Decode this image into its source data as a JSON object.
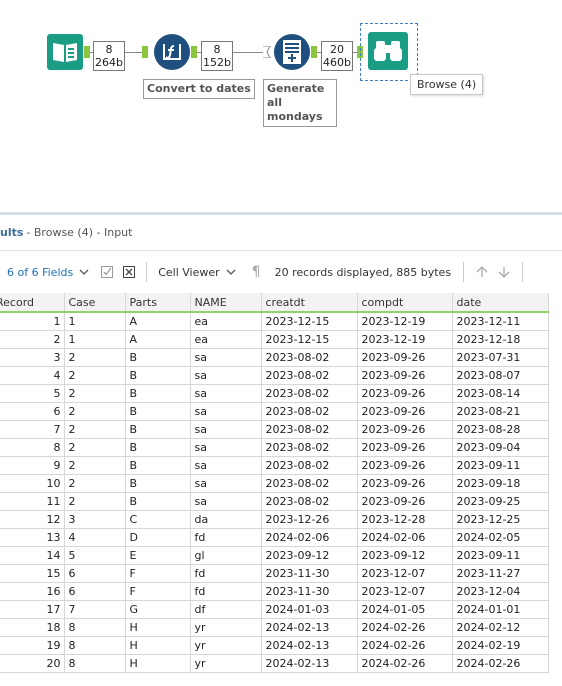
{
  "workflow": {
    "connections": [
      {
        "records": "8",
        "size": "264b"
      },
      {
        "records": "8",
        "size": "152b"
      },
      {
        "records": "20",
        "size": "460b"
      }
    ],
    "tools": {
      "formula_label": "Convert to dates",
      "generate_label": "Generate all mondays"
    },
    "tooltip": "Browse (4)"
  },
  "results": {
    "title": "ults",
    "subtitle": "- Browse (4) - Input"
  },
  "toolbar": {
    "fields_label": "6 of 6 Fields",
    "cell_viewer_label": "Cell Viewer",
    "records_info": "20 records displayed, 885 bytes"
  },
  "colors": {
    "accent": "#1f6fb5",
    "tool_teal": "#1a9c85",
    "tool_navy": "#1f4f7f",
    "anchor_green": "#8cc63f",
    "header_green_line": "#8fd26a"
  },
  "table": {
    "columns": [
      "Record",
      "Case",
      "Parts",
      "NAME",
      "creatdt",
      "compdt",
      "date"
    ],
    "rows": [
      [
        "1",
        "1",
        "A",
        "ea",
        "2023-12-15",
        "2023-12-19",
        "2023-12-11"
      ],
      [
        "2",
        "1",
        "A",
        "ea",
        "2023-12-15",
        "2023-12-19",
        "2023-12-18"
      ],
      [
        "3",
        "2",
        "B",
        "sa",
        "2023-08-02",
        "2023-09-26",
        "2023-07-31"
      ],
      [
        "4",
        "2",
        "B",
        "sa",
        "2023-08-02",
        "2023-09-26",
        "2023-08-07"
      ],
      [
        "5",
        "2",
        "B",
        "sa",
        "2023-08-02",
        "2023-09-26",
        "2023-08-14"
      ],
      [
        "6",
        "2",
        "B",
        "sa",
        "2023-08-02",
        "2023-09-26",
        "2023-08-21"
      ],
      [
        "7",
        "2",
        "B",
        "sa",
        "2023-08-02",
        "2023-09-26",
        "2023-08-28"
      ],
      [
        "8",
        "2",
        "B",
        "sa",
        "2023-08-02",
        "2023-09-26",
        "2023-09-04"
      ],
      [
        "9",
        "2",
        "B",
        "sa",
        "2023-08-02",
        "2023-09-26",
        "2023-09-11"
      ],
      [
        "10",
        "2",
        "B",
        "sa",
        "2023-08-02",
        "2023-09-26",
        "2023-09-18"
      ],
      [
        "11",
        "2",
        "B",
        "sa",
        "2023-08-02",
        "2023-09-26",
        "2023-09-25"
      ],
      [
        "12",
        "3",
        "C",
        "da",
        "2023-12-26",
        "2023-12-28",
        "2023-12-25"
      ],
      [
        "13",
        "4",
        "D",
        "fd",
        "2024-02-06",
        "2024-02-06",
        "2024-02-05"
      ],
      [
        "14",
        "5",
        "E",
        "gl",
        "2023-09-12",
        "2023-09-12",
        "2023-09-11"
      ],
      [
        "15",
        "6",
        "F",
        "fd",
        "2023-11-30",
        "2023-12-07",
        "2023-11-27"
      ],
      [
        "16",
        "6",
        "F",
        "fd",
        "2023-11-30",
        "2023-12-07",
        "2023-12-04"
      ],
      [
        "17",
        "7",
        "G",
        "df",
        "2024-01-03",
        "2024-01-05",
        "2024-01-01"
      ],
      [
        "18",
        "8",
        "H",
        "yr",
        "2024-02-13",
        "2024-02-26",
        "2024-02-12"
      ],
      [
        "19",
        "8",
        "H",
        "yr",
        "2024-02-13",
        "2024-02-26",
        "2024-02-19"
      ],
      [
        "20",
        "8",
        "H",
        "yr",
        "2024-02-13",
        "2024-02-26",
        "2024-02-26"
      ]
    ]
  }
}
